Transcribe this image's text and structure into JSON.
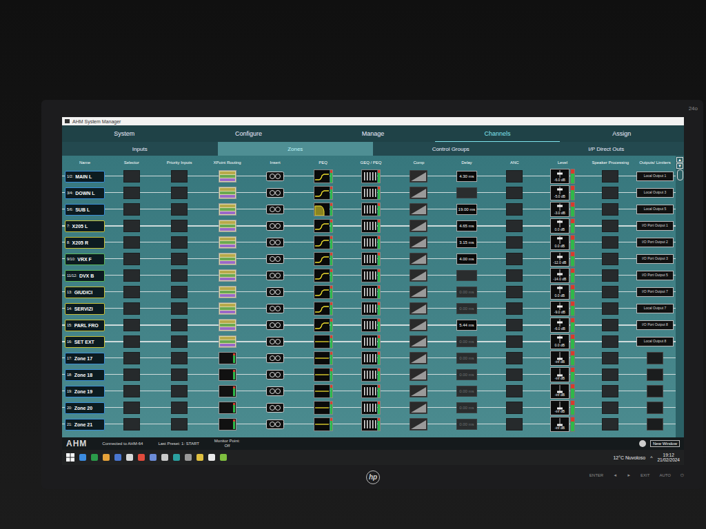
{
  "window": {
    "title": "AHM System Manager"
  },
  "monitor": {
    "model": "24o",
    "brand": "hp",
    "buttons": [
      "ENTER",
      "◄",
      "►",
      "EXIT",
      "AUTO",
      "⏻"
    ]
  },
  "tabs": [
    {
      "label": "System",
      "selected": false
    },
    {
      "label": "Configure",
      "selected": false
    },
    {
      "label": "Manage",
      "selected": false
    },
    {
      "label": "Channels",
      "selected": true
    },
    {
      "label": "Assign",
      "selected": false
    }
  ],
  "subtabs": [
    {
      "label": "Inputs",
      "selected": false
    },
    {
      "label": "Zones",
      "selected": true
    },
    {
      "label": "Control Groups",
      "selected": false
    },
    {
      "label": "I/P Direct Outs",
      "selected": false
    }
  ],
  "table": {
    "columns": [
      "Name",
      "Selector",
      "Priority Inputs",
      "XPoint Routing",
      "Insert",
      "PEQ",
      "GEQ / PEQ",
      "Comp",
      "Delay",
      "ANC",
      "Level",
      "Speaker Processing",
      "Outputs/ Limiters"
    ],
    "scroll": {
      "up": "▲",
      "down": "▼"
    },
    "rows": [
      {
        "num": "1/2:",
        "name": "MAIN L",
        "color": "#3a8fd8",
        "routed": true,
        "peq": "curve",
        "delay": "4.30 ms",
        "delay_active": true,
        "level": 0.55,
        "reading": "-6.0 dB",
        "output": "Local Output 1"
      },
      {
        "num": "3/4:",
        "name": "DOWN L",
        "color": "#3a8fd8",
        "routed": true,
        "peq": "curve",
        "delay": "",
        "delay_active": false,
        "level": 0.6,
        "reading": "-5.0 dB",
        "output": "Local Output 3"
      },
      {
        "num": "5/6:",
        "name": "SUB L",
        "color": "#3a8fd8",
        "routed": true,
        "peq": "sub",
        "delay": "19.00 ms",
        "delay_active": true,
        "level": 0.6,
        "reading": "-3.0 dB",
        "output": "Local Output 5"
      },
      {
        "num": "7:",
        "name": "X205 L",
        "color": "#c9c23a",
        "routed": true,
        "peq": "curve",
        "delay": "4.65 ms",
        "delay_active": true,
        "level": 0.7,
        "reading": "0.0 dB",
        "output": "I/O Port Output 1"
      },
      {
        "num": "8:",
        "name": "X205 R",
        "color": "#c9c23a",
        "routed": true,
        "peq": "curve",
        "delay": "3.15 ms",
        "delay_active": true,
        "level": 0.7,
        "reading": "0.0 dB",
        "output": "I/O Port Output 2"
      },
      {
        "num": "9/10:",
        "name": "VRX F",
        "color": "#5cb85c",
        "routed": true,
        "peq": "curve",
        "delay": "4.00 ms",
        "delay_active": true,
        "level": 0.45,
        "reading": "-12.0 dB",
        "output": "I/O Port Output 3"
      },
      {
        "num": "11/12:",
        "name": "DVX B",
        "color": "#5cb85c",
        "routed": true,
        "peq": "curve",
        "delay": "",
        "delay_active": false,
        "level": 0.4,
        "reading": "-14.0 dB",
        "output": "I/O Port Output 5"
      },
      {
        "num": "13:",
        "name": "GIUDICI",
        "color": "#c9c23a",
        "routed": true,
        "peq": "curve",
        "delay": "0.00 ms",
        "delay_active": false,
        "level": 0.7,
        "reading": "0.0 dB",
        "output": "I/O Port Output 7"
      },
      {
        "num": "14:",
        "name": "SERVIZI",
        "color": "#c9c23a",
        "routed": true,
        "peq": "curve",
        "delay": "0.00 ms",
        "delay_active": false,
        "level": 0.5,
        "reading": "-9.0 dB",
        "output": "Local Output 7"
      },
      {
        "num": "15:",
        "name": "PARL FRO",
        "color": "#c9c23a",
        "routed": true,
        "peq": "curve",
        "delay": "5.44 ms",
        "delay_active": true,
        "level": 0.55,
        "reading": "-6.0 dB",
        "output": "I/O Port Output 8"
      },
      {
        "num": "16:",
        "name": "SET EXT",
        "color": "#c9c23a",
        "routed": true,
        "peq": "flat",
        "delay": "0.00 ms",
        "delay_active": false,
        "level": 0.7,
        "reading": "0.0 dB",
        "output": "Local Output 8"
      },
      {
        "num": "17:",
        "name": "Zone 17",
        "color": "#3a8fd8",
        "routed": false,
        "peq": "flat",
        "delay": "0.00 ms",
        "delay_active": false,
        "level": 0.1,
        "reading": "-inf dB",
        "output": ""
      },
      {
        "num": "18:",
        "name": "Zone 18",
        "color": "#3a8fd8",
        "routed": false,
        "peq": "flat",
        "delay": "0.00 ms",
        "delay_active": false,
        "level": 0.1,
        "reading": "-inf dB",
        "output": ""
      },
      {
        "num": "19:",
        "name": "Zone 19",
        "color": "#3a8fd8",
        "routed": false,
        "peq": "flat",
        "delay": "0.00 ms",
        "delay_active": false,
        "level": 0.1,
        "reading": "-inf dB",
        "output": ""
      },
      {
        "num": "20:",
        "name": "Zone 20",
        "color": "#3a8fd8",
        "routed": false,
        "peq": "flat",
        "delay": "0.00 ms",
        "delay_active": false,
        "level": 0.1,
        "reading": "-inf dB",
        "output": ""
      },
      {
        "num": "21:",
        "name": "Zone 21",
        "color": "#3a8fd8",
        "routed": false,
        "peq": "flat",
        "delay": "0.00 ms",
        "delay_active": false,
        "level": 0.1,
        "reading": "-inf dB",
        "output": ""
      }
    ]
  },
  "status_bar": {
    "logo": "AHM",
    "connection": "Connected to AHM-64",
    "preset": "Last Preset: 1: START",
    "monitor_label": "Monitor Point:",
    "monitor_value": "Off",
    "button": "New Window"
  },
  "taskbar": {
    "weather": "12°C Nuvoloso",
    "tray": "^",
    "time": "19:12",
    "date": "21/02/2024"
  }
}
